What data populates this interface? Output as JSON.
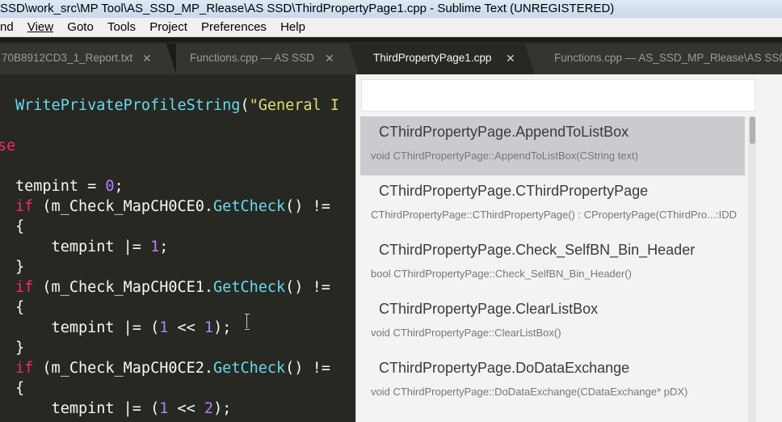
{
  "window": {
    "title": "SSD\\work_src\\MP Tool\\AS_SSD_MP_Rlease\\AS SSD\\ThirdPropertyPage1.cpp - Sublime Text (UNREGISTERED)"
  },
  "menu": {
    "items": [
      {
        "label": "nd"
      },
      {
        "label": "View"
      },
      {
        "label": "Goto"
      },
      {
        "label": "Tools"
      },
      {
        "label": "Project"
      },
      {
        "label": "Preferences"
      },
      {
        "label": "Help"
      }
    ]
  },
  "tabs": [
    {
      "label": "70B8912CD3_1_Report.txt",
      "close": "✕",
      "active": false
    },
    {
      "label": "Functions.cpp — AS SSD",
      "close": "✕",
      "active": false
    },
    {
      "label": "ThirdPropertyPage1.cpp",
      "close": "✕",
      "active": true
    },
    {
      "label": "Functions.cpp — AS_SSD_MP_Rlease\\AS SSD",
      "close": "",
      "active": false
    }
  ],
  "code": {
    "line1": {
      "fn": "WritePrivateProfileString",
      "rest": "(",
      "str": "\"General I"
    },
    "line2": {
      "kw": "se"
    },
    "line3": {
      "a": "tempint = ",
      "num": "0",
      "b": ";"
    },
    "line4": {
      "kw": "if",
      "a": " (m_Check_MapCH0CE0.",
      "fn": "GetCheck",
      "b": "() != "
    },
    "line5": {
      "a": "{"
    },
    "line6": {
      "a": "    tempint |= ",
      "num": "1",
      "b": ";"
    },
    "line7": {
      "a": "}"
    },
    "line8": {
      "kw": "if",
      "a": " (m_Check_MapCH0CE1.",
      "fn": "GetCheck",
      "b": "() != "
    },
    "line9": {
      "a": "{"
    },
    "line10": {
      "a": "    tempint |= (",
      "num1": "1",
      "op": " << ",
      "num2": "1",
      "b": ");"
    },
    "line11": {
      "a": "}"
    },
    "line12": {
      "kw": "if",
      "a": " (m_Check_MapCH0CE2.",
      "fn": "GetCheck",
      "b": "() != "
    },
    "line13": {
      "a": "{"
    },
    "line14": {
      "a": "    tempint |= (",
      "num1": "1",
      "op": " << ",
      "num2": "2",
      "b": ");"
    }
  },
  "goto_symbol": {
    "query": "",
    "items": [
      {
        "name": "CThirdPropertyPage.AppendToListBox",
        "signature": "void CThirdPropertyPage::AppendToListBox(CString text)",
        "selected": true
      },
      {
        "name": "CThirdPropertyPage.CThirdPropertyPage",
        "signature": "CThirdPropertyPage::CThirdPropertyPage() : CPropertyPage(CThirdPro...:IDD",
        "selected": false
      },
      {
        "name": "CThirdPropertyPage.Check_SelfBN_Bin_Header",
        "signature": "bool CThirdPropertyPage::Check_SelfBN_Bin_Header()",
        "selected": false
      },
      {
        "name": "CThirdPropertyPage.ClearListBox",
        "signature": "void CThirdPropertyPage::ClearListBox()",
        "selected": false
      },
      {
        "name": "CThirdPropertyPage.DoDataExchange",
        "signature": "void CThirdPropertyPage::DoDataExchange(CDataExchange* pDX)",
        "selected": false
      }
    ]
  },
  "colors": {
    "editor_bg": "#272822",
    "keyword": "#f92672",
    "function": "#66d9ef",
    "number": "#ae81ff",
    "string": "#e6db74",
    "overlay_bg": "#f3f3f3",
    "selected_item_bg": "#cbcbcf"
  }
}
